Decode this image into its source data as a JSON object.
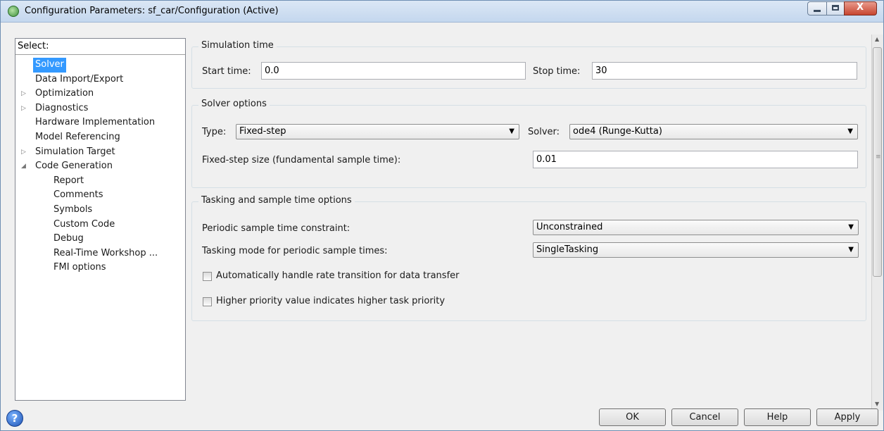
{
  "window": {
    "title": "Configuration Parameters: sf_car/Configuration (Active)",
    "controls": {
      "minimize": "–",
      "maximize": "□",
      "close": "X"
    }
  },
  "tree": {
    "header": "Select:",
    "items": [
      {
        "label": "Solver",
        "selected": true,
        "expander": ""
      },
      {
        "label": "Data Import/Export",
        "expander": ""
      },
      {
        "label": "Optimization",
        "expander": "▷"
      },
      {
        "label": "Diagnostics",
        "expander": "▷"
      },
      {
        "label": "Hardware Implementation",
        "expander": ""
      },
      {
        "label": "Model Referencing",
        "expander": ""
      },
      {
        "label": "Simulation Target",
        "expander": "▷"
      },
      {
        "label": "Code Generation",
        "expander": "◢"
      },
      {
        "label": "Report",
        "expander": ""
      },
      {
        "label": "Comments",
        "expander": ""
      },
      {
        "label": "Symbols",
        "expander": ""
      },
      {
        "label": "Custom Code",
        "expander": ""
      },
      {
        "label": "Debug",
        "expander": ""
      },
      {
        "label": "Real-Time Workshop ...",
        "expander": ""
      },
      {
        "label": "FMI options",
        "expander": ""
      }
    ]
  },
  "simulation_time": {
    "title": "Simulation time",
    "start_label": "Start time:",
    "start_value": "0.0",
    "stop_label": "Stop time:",
    "stop_value": "30"
  },
  "solver_options": {
    "title": "Solver options",
    "type_label": "Type:",
    "type_value": "Fixed-step",
    "solver_label": "Solver:",
    "solver_value": "ode4 (Runge-Kutta)",
    "step_label": "Fixed-step size (fundamental sample time):",
    "step_value": "0.01"
  },
  "tasking": {
    "title": "Tasking and sample time options",
    "periodic_label": "Periodic sample time constraint:",
    "periodic_value": "Unconstrained",
    "mode_label": "Tasking mode for periodic sample times:",
    "mode_value": "SingleTasking",
    "auto_rate_label": "Automatically handle rate transition for data transfer",
    "auto_rate_checked": false,
    "higher_priority_label": "Higher priority value indicates higher task priority",
    "higher_priority_checked": false
  },
  "footer": {
    "help_icon": "?",
    "ok": "OK",
    "cancel": "Cancel",
    "help": "Help",
    "apply": "Apply"
  }
}
